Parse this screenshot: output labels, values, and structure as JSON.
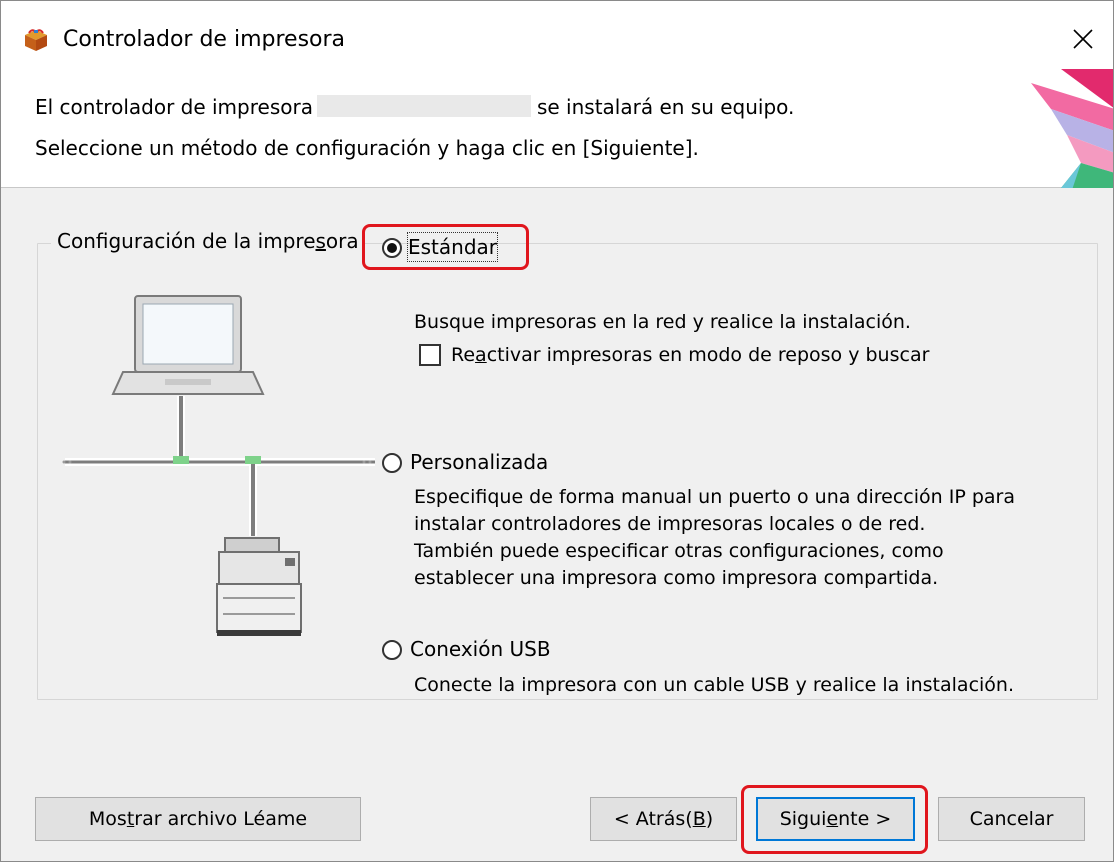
{
  "window": {
    "title": "Controlador de impresora",
    "close_symbol": "✕"
  },
  "header": {
    "line1_before": "El controlador de impresora",
    "line1_after": "se instalará en su equipo.",
    "line2": "Seleccione un método de configuración y haga clic en [Siguiente]."
  },
  "group": {
    "label_pre": "Configuración de la impre",
    "label_u": "s",
    "label_post": "ora"
  },
  "options": {
    "standard": {
      "label": "Estándar",
      "checked": true,
      "description": "Busque impresoras en la red y realice la instalación.",
      "checkbox_pre": "Re",
      "checkbox_u": "a",
      "checkbox_post": "ctivar impresoras en modo de reposo y buscar",
      "checkbox_checked": false
    },
    "custom": {
      "label": "Personalizada",
      "checked": false,
      "description_lines": [
        "Especifique de forma manual un puerto o una dirección IP para",
        "instalar controladores de impresoras locales o de red.",
        "También puede especificar otras configuraciones, como",
        "establecer una impresora como impresora compartida."
      ]
    },
    "usb": {
      "label": "Conexión USB",
      "checked": false,
      "description": "Conecte la impresora con un cable USB y realice la instalación."
    }
  },
  "buttons": {
    "readme_pre": "Mos",
    "readme_u": "t",
    "readme_post": "rar archivo Léame",
    "back_pre": "< Atrás(",
    "back_u": "B",
    "back_post": ")",
    "next_pre": "Sigui",
    "next_u": "e",
    "next_post": "nte >",
    "cancel": "Cancelar"
  },
  "colors": {
    "highlight": "#e0161d",
    "default_button_border": "#0078d7",
    "content_bg": "#f0f0f0",
    "network_connector": "#7ed28a"
  },
  "icons": {
    "app": "printer-package-icon",
    "close": "close-icon",
    "laptop": "laptop-icon",
    "printer": "multifunction-printer-icon"
  }
}
